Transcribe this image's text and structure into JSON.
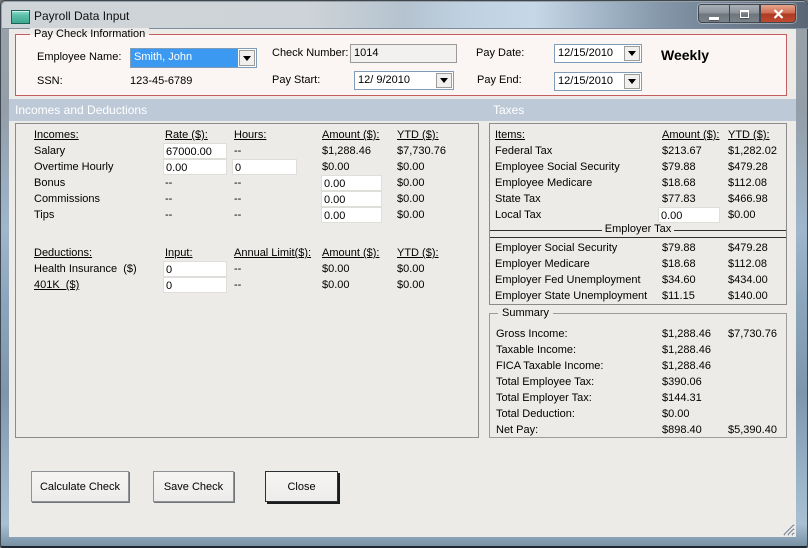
{
  "window": {
    "title": "Payroll Data Input"
  },
  "paycheck": {
    "group_label": "Pay Check Information",
    "employee_name_label": "Employee Name:",
    "employee_name_value": "Smith, John",
    "ssn_label": "SSN:",
    "ssn_value": "123-45-6789",
    "check_number_label": "Check Number:",
    "check_number_value": "1014",
    "pay_start_label": "Pay Start:",
    "pay_start_value": "12/ 9/2010",
    "pay_date_label": "Pay Date:",
    "pay_date_value": "12/15/2010",
    "pay_end_label": "Pay End:",
    "pay_end_value": "12/15/2010",
    "frequency": "Weekly"
  },
  "sections": {
    "left": "Incomes and Deductions",
    "right": "Taxes"
  },
  "incomes": {
    "headers": {
      "item": "Incomes:",
      "rate": "Rate ($):",
      "hours": "Hours:",
      "amount": "Amount ($):",
      "ytd": "YTD ($):"
    },
    "rows": [
      {
        "label": "Salary",
        "rate": "67000.00",
        "hours": "--",
        "amount": "$1,288.46",
        "ytd": "$7,730.76"
      },
      {
        "label": "Overtime Hourly",
        "rate": "0.00",
        "hours": "0",
        "amount": "$0.00",
        "ytd": "$0.00"
      },
      {
        "label": "Bonus",
        "rate": "--",
        "hours": "--",
        "amount": "0.00",
        "ytd": "$0.00"
      },
      {
        "label": "Commissions",
        "rate": "--",
        "hours": "--",
        "amount": "0.00",
        "ytd": "$0.00"
      },
      {
        "label": "Tips",
        "rate": "--",
        "hours": "--",
        "amount": "0.00",
        "ytd": "$0.00"
      }
    ]
  },
  "deductions": {
    "headers": {
      "item": "Deductions:",
      "input": "Input:",
      "limit": "Annual Limit($):",
      "amount": "Amount ($):",
      "ytd": "YTD ($):"
    },
    "rows": [
      {
        "label": "Health Insurance  ($)",
        "input": "0",
        "limit": "--",
        "amount": "$0.00",
        "ytd": "$0.00"
      },
      {
        "label": "401K  ($)",
        "input": "0",
        "limit": "--",
        "amount": "$0.00",
        "ytd": "$0.00"
      }
    ]
  },
  "taxes": {
    "headers": {
      "item": "Items:",
      "amount": "Amount ($):",
      "ytd": "YTD ($):"
    },
    "employee_rows": [
      {
        "label": "Federal Tax",
        "amount": "$213.67",
        "ytd": "$1,282.02"
      },
      {
        "label": "Employee Social Security",
        "amount": "$79.88",
        "ytd": "$479.28"
      },
      {
        "label": "Employee Medicare",
        "amount": "$18.68",
        "ytd": "$112.08"
      },
      {
        "label": "State Tax",
        "amount": "$77.83",
        "ytd": "$466.98"
      },
      {
        "label": "Local Tax",
        "amount": "0.00",
        "ytd": "$0.00"
      }
    ],
    "employer_header": "Employer Tax",
    "employer_rows": [
      {
        "label": "Employer Social Security",
        "amount": "$79.88",
        "ytd": "$479.28"
      },
      {
        "label": "Employer Medicare",
        "amount": "$18.68",
        "ytd": "$112.08"
      },
      {
        "label": "Employer Fed Unemployment",
        "amount": "$34.60",
        "ytd": "$434.00"
      },
      {
        "label": "Employer State Unemployment",
        "amount": "$11.15",
        "ytd": "$140.00"
      }
    ]
  },
  "summary": {
    "group_label": "Summary",
    "rows": [
      {
        "label": "Gross Income:",
        "amount": "$1,288.46",
        "ytd": "$7,730.76"
      },
      {
        "label": "Taxable Income:",
        "amount": "$1,288.46",
        "ytd": ""
      },
      {
        "label": "FICA Taxable Income:",
        "amount": "$1,288.46",
        "ytd": ""
      },
      {
        "label": "Total Employee Tax:",
        "amount": "$390.06",
        "ytd": ""
      },
      {
        "label": "Total Employer Tax:",
        "amount": "$144.31",
        "ytd": ""
      },
      {
        "label": "Total Deduction:",
        "amount": "$0.00",
        "ytd": ""
      },
      {
        "label": "Net Pay:",
        "amount": "$898.40",
        "ytd": "$5,390.40"
      }
    ]
  },
  "buttons": {
    "calculate": "Calculate Check",
    "save": "Save Check",
    "close": "Close"
  }
}
